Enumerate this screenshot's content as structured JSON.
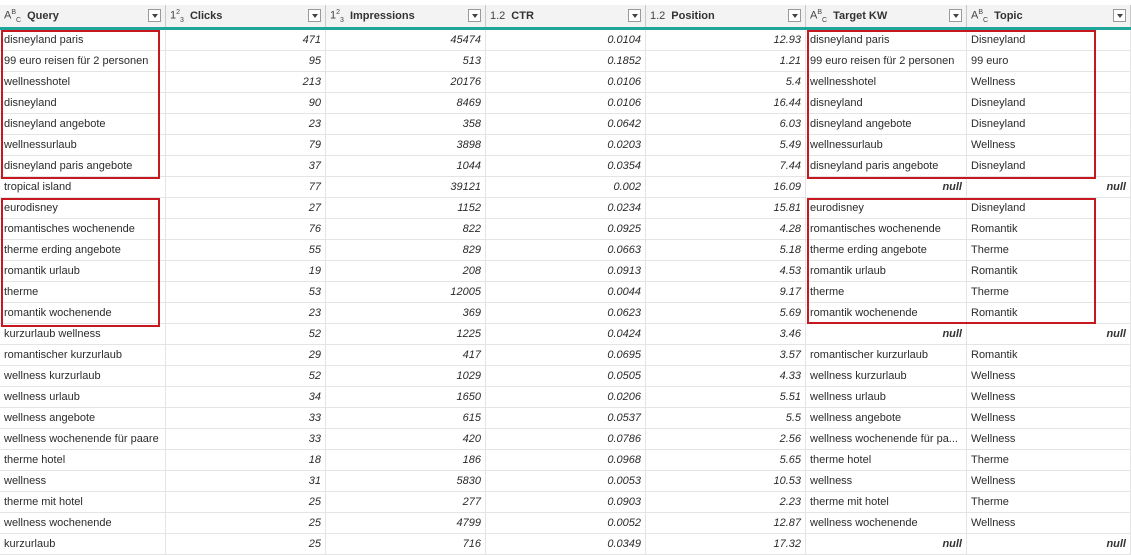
{
  "columns": [
    {
      "type": "ABC",
      "label": "Query",
      "align": "left"
    },
    {
      "type": "123",
      "label": "Clicks",
      "align": "right"
    },
    {
      "type": "123",
      "label": "Impressions",
      "align": "right"
    },
    {
      "type": "1.2",
      "label": "CTR",
      "align": "right"
    },
    {
      "type": "1.2",
      "label": "Position",
      "align": "right"
    },
    {
      "type": "ABC",
      "label": "Target KW",
      "align": "left"
    },
    {
      "type": "ABC",
      "label": "Topic",
      "align": "left"
    }
  ],
  "rows": [
    [
      "disneyland paris",
      "471",
      "45474",
      "0.0104",
      "12.93",
      "disneyland paris",
      "Disneyland"
    ],
    [
      "99 euro reisen für 2 personen",
      "95",
      "513",
      "0.1852",
      "1.21",
      "99 euro reisen für 2 personen",
      "99 euro"
    ],
    [
      "wellnesshotel",
      "213",
      "20176",
      "0.0106",
      "5.4",
      "wellnesshotel",
      "Wellness"
    ],
    [
      "disneyland",
      "90",
      "8469",
      "0.0106",
      "16.44",
      "disneyland",
      "Disneyland"
    ],
    [
      "disneyland angebote",
      "23",
      "358",
      "0.0642",
      "6.03",
      "disneyland angebote",
      "Disneyland"
    ],
    [
      "wellnessurlaub",
      "79",
      "3898",
      "0.0203",
      "5.49",
      "wellnessurlaub",
      "Wellness"
    ],
    [
      "disneyland paris angebote",
      "37",
      "1044",
      "0.0354",
      "7.44",
      "disneyland paris angebote",
      "Disneyland"
    ],
    [
      "tropical island",
      "77",
      "39121",
      "0.002",
      "16.09",
      "null",
      "null"
    ],
    [
      "eurodisney",
      "27",
      "1152",
      "0.0234",
      "15.81",
      "eurodisney",
      "Disneyland"
    ],
    [
      "romantisches wochenende",
      "76",
      "822",
      "0.0925",
      "4.28",
      "romantisches wochenende",
      "Romantik"
    ],
    [
      "therme erding angebote",
      "55",
      "829",
      "0.0663",
      "5.18",
      "therme erding angebote",
      "Therme"
    ],
    [
      "romantik urlaub",
      "19",
      "208",
      "0.0913",
      "4.53",
      "romantik urlaub",
      "Romantik"
    ],
    [
      "therme",
      "53",
      "12005",
      "0.0044",
      "9.17",
      "therme",
      "Therme"
    ],
    [
      "romantik wochenende",
      "23",
      "369",
      "0.0623",
      "5.69",
      "romantik wochenende",
      "Romantik"
    ],
    [
      "kurzurlaub wellness",
      "52",
      "1225",
      "0.0424",
      "3.46",
      "null",
      "null"
    ],
    [
      "romantischer kurzurlaub",
      "29",
      "417",
      "0.0695",
      "3.57",
      "romantischer kurzurlaub",
      "Romantik"
    ],
    [
      "wellness kurzurlaub",
      "52",
      "1029",
      "0.0505",
      "4.33",
      "wellness kurzurlaub",
      "Wellness"
    ],
    [
      "wellness urlaub",
      "34",
      "1650",
      "0.0206",
      "5.51",
      "wellness urlaub",
      "Wellness"
    ],
    [
      "wellness angebote",
      "33",
      "615",
      "0.0537",
      "5.5",
      "wellness angebote",
      "Wellness"
    ],
    [
      "wellness wochenende für paare",
      "33",
      "420",
      "0.0786",
      "2.56",
      "wellness wochenende für pa...",
      "Wellness"
    ],
    [
      "therme hotel",
      "18",
      "186",
      "0.0968",
      "5.65",
      "therme hotel",
      "Therme"
    ],
    [
      "wellness",
      "31",
      "5830",
      "0.0053",
      "10.53",
      "wellness",
      "Wellness"
    ],
    [
      "therme mit hotel",
      "25",
      "277",
      "0.0903",
      "2.23",
      "therme mit hotel",
      "Therme"
    ],
    [
      "wellness wochenende",
      "25",
      "4799",
      "0.0052",
      "12.87",
      "wellness wochenende",
      "Wellness"
    ],
    [
      "kurzurlaub",
      "25",
      "716",
      "0.0349",
      "17.32",
      "null",
      "null"
    ]
  ],
  "colors": {
    "accent": "#1fa59a",
    "highlight": "#c8181f"
  }
}
